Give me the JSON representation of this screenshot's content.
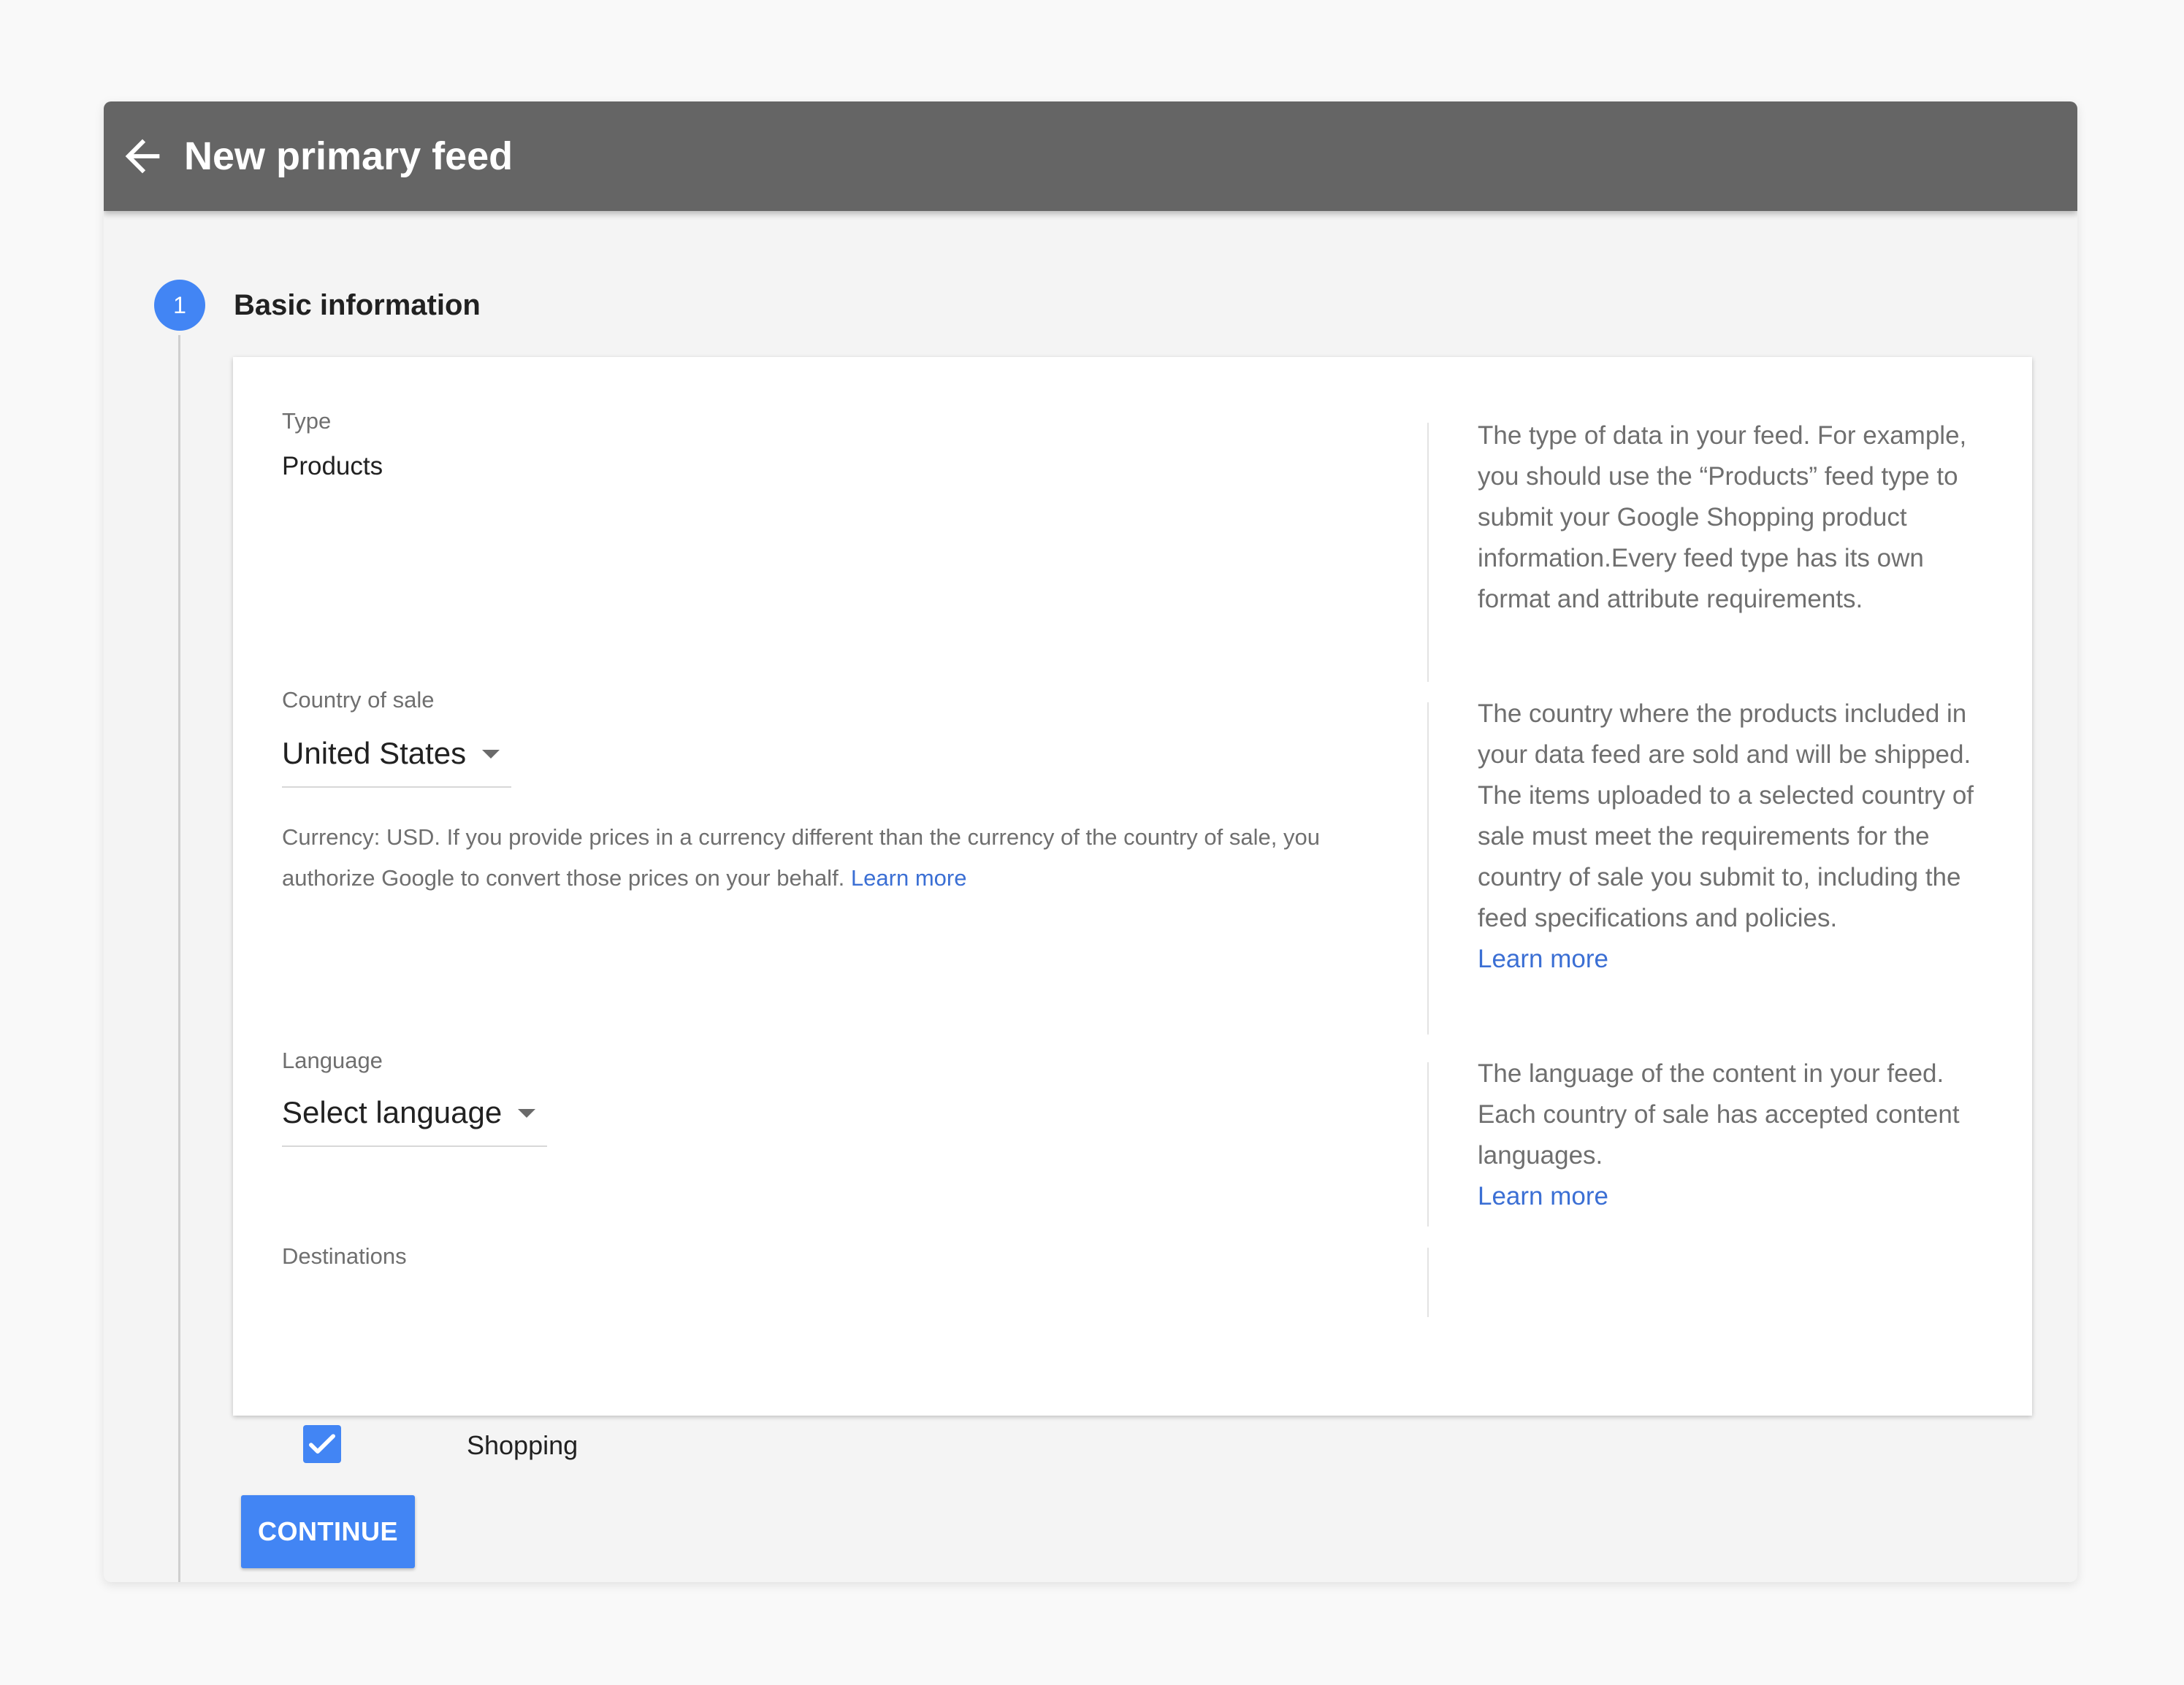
{
  "header": {
    "title": "New primary feed",
    "back_icon": "arrow-left-icon"
  },
  "step": {
    "number": "1",
    "title": "Basic information"
  },
  "fields": {
    "type": {
      "label": "Type",
      "value": "Products",
      "help": "The type of data in your feed. For example, you should use the “Products” feed type to submit your Google Shopping product information.Every feed type has its own format and attribute requirements."
    },
    "country": {
      "label": "Country of sale",
      "selected": "United States",
      "note": "Currency: USD. If you provide prices in a currency different than the currency of the country of sale, you authorize Google to convert those prices on your behalf.",
      "note_link": "Learn more",
      "help": "The country where the products included in your data feed are sold and will be shipped. The items uploaded to a selected country of sale must meet the requirements for the country of sale you submit to, including the feed specifications and policies.",
      "help_link": "Learn more"
    },
    "language": {
      "label": "Language",
      "selected": "Select language",
      "help": "The language of the content in your feed. Each country of sale has accepted content languages.",
      "help_link": "Learn more"
    },
    "destinations": {
      "label": "Destinations",
      "options": [
        {
          "label": "Shopping",
          "checked": true
        }
      ]
    }
  },
  "actions": {
    "continue_label": "CONTINUE"
  },
  "colors": {
    "header_bg": "#656565",
    "accent": "#4285f4",
    "link": "#3b6fd4"
  }
}
